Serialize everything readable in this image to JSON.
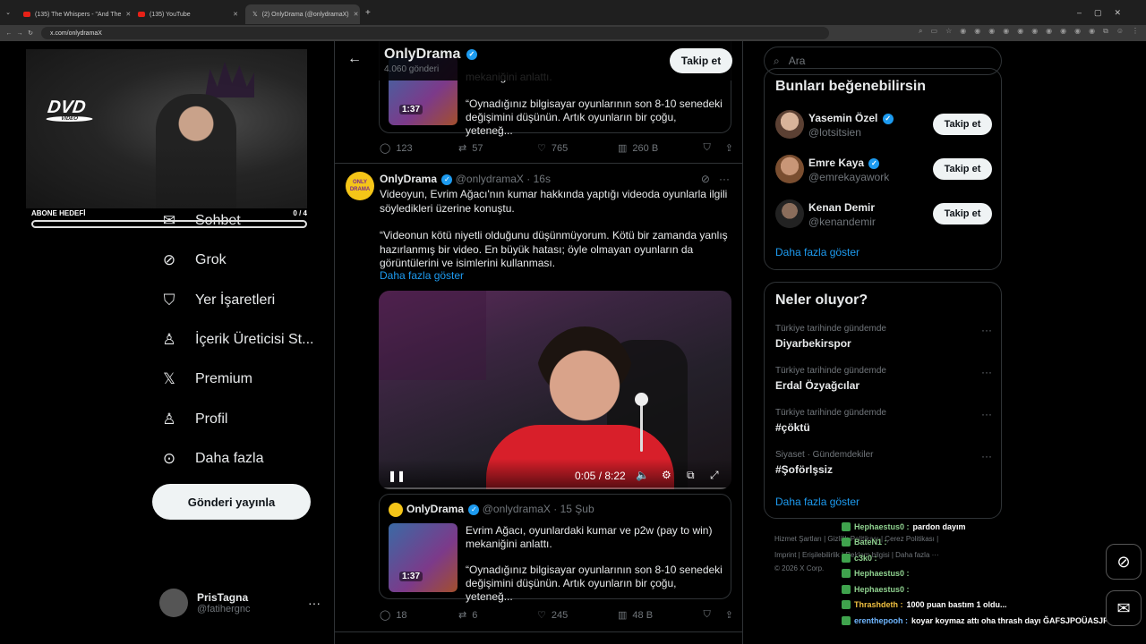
{
  "browser": {
    "tabs": [
      {
        "label": "(135) The Whispers - \"And The"
      },
      {
        "label": "(135) YouTube"
      },
      {
        "label": "(2) OnlyDrama (@onlydramaX)"
      }
    ],
    "url": "x.com/onlydramaX"
  },
  "stream": {
    "dvd_text": "DVD",
    "dvd_sub": "VIDEO",
    "goal_label": "ABONE HEDEFİ",
    "goal_count": "0 / 4"
  },
  "nav": {
    "items": [
      {
        "label": "Sohbet",
        "icon": "mail-icon"
      },
      {
        "label": "Grok",
        "icon": "grok-icon"
      },
      {
        "label": "Yer İşaretleri",
        "icon": "bookmark-icon"
      },
      {
        "label": "İçerik Üreticisi St...",
        "icon": "creator-studio-icon"
      },
      {
        "label": "Premium",
        "icon": "x-logo-icon"
      },
      {
        "label": "Profil",
        "icon": "profile-icon"
      },
      {
        "label": "Daha fazla",
        "icon": "more-circle-icon"
      }
    ],
    "post_button": "Gönderi yayınla",
    "account": {
      "name": "PrisTagna",
      "handle": "@fatihergnc"
    }
  },
  "header": {
    "title": "OnlyDrama",
    "subtitle": "4.060 gönderi",
    "follow": "Takip et"
  },
  "top_quote": {
    "line1": "mekaniğini anlattı.",
    "duration": "1:37",
    "text": "“Oynadığınız bilgisayar oyunlarının son 8-10 senedeki değişimini düşünün. Artık oyunların bir çoğu, yeteneğ..."
  },
  "top_actions": {
    "replies": "123",
    "reposts": "57",
    "likes": "765",
    "views": "260 B"
  },
  "tweet": {
    "avatar_text": "ONLY DRAMA",
    "name": "OnlyDrama",
    "handle": "@onlydramaX · 16s",
    "text1": "Videoyun, Evrim Ağacı'nın kumar hakkında yaptığı videoda oyunlarla ilgili söyledikleri üzerine konuştu.",
    "text2": "“Videonun kötü niyetli olduğunu düşünmüyorum. Kötü bir zamanda yanlış hazırlanmış bir video. En büyük hatası; öyle olmayan oyunların da görüntülerini ve isimlerini kullanması.",
    "show_more": "Daha fazla göster",
    "video_time": "0:05 / 8:22",
    "video_progress": 0.01,
    "volume_level": 1.0,
    "quote": {
      "name": "OnlyDrama",
      "handle": "@onlydramaX · 15 Şub",
      "line1": "Evrim Ağacı, oyunlardaki kumar ve p2w (pay to win) mekaniğini anlattı.",
      "duration": "1:37",
      "text": "“Oynadığınız bilgisayar oyunlarının son 8-10 senedeki değişimini düşünün. Artık oyunların bir çoğu, yeteneğ..."
    },
    "actions": {
      "replies": "18",
      "reposts": "6",
      "likes": "245",
      "views": "48 B"
    }
  },
  "sidebar": {
    "search_placeholder": "Ara",
    "suggest_title": "Bunları beğenebilirsin",
    "suggestions": [
      {
        "name": "Yasemin Özel",
        "handle": "@lotsitsien",
        "button": "Takip et"
      },
      {
        "name": "Emre Kaya",
        "handle": "@emrekayawork",
        "button": "Takip et"
      },
      {
        "name": "Kenan Demir",
        "handle": "@kenandemir",
        "button": "Takip et"
      }
    ],
    "suggest_more": "Daha fazla göster",
    "trends_title": "Neler oluyor?",
    "trends": [
      {
        "category": "Türkiye tarihinde gündemde",
        "title": "Diyarbekirspor"
      },
      {
        "category": "Türkiye tarihinde gündemde",
        "title": "Erdal Özyağcılar"
      },
      {
        "category": "Türkiye tarihinde gündemde",
        "title": "#çöktü"
      },
      {
        "category": "Siyaset · Gündemdekiler",
        "title": "#Şoförlşsiz"
      }
    ],
    "trends_more": "Daha fazla göster",
    "footer1": "Hizmet Şartları  |  Gizlilik Politikası  |  Çerez Politikası  |",
    "footer2": "Imprint  |  Erişilebilirlik  |  Reklam bilgisi  |  Daha fazla ···",
    "footer3": "© 2026 X Corp."
  },
  "chat": [
    {
      "user": "Hephaestus0 :",
      "msg": "pardon dayım",
      "color": "#8fd18f"
    },
    {
      "user": "BateN1 :",
      "msg": "",
      "color": "#8fd18f"
    },
    {
      "user": "c3k0 :",
      "msg": "",
      "color": "#8fd18f"
    },
    {
      "user": "Hephaestus0 :",
      "msg": "",
      "color": "#8fd18f"
    },
    {
      "user": "Hephaestus0 :",
      "msg": "",
      "color": "#8fd18f"
    },
    {
      "user": "Thrashdeth :",
      "msg": "1000 puan bastım 1 oldu...",
      "color": "#f0c040"
    },
    {
      "user": "erenthepooh :",
      "msg": "koyar koymaz attı oha thrash dayı ĞAFSJPOÜASJF",
      "color": "#6fb6ff"
    }
  ]
}
